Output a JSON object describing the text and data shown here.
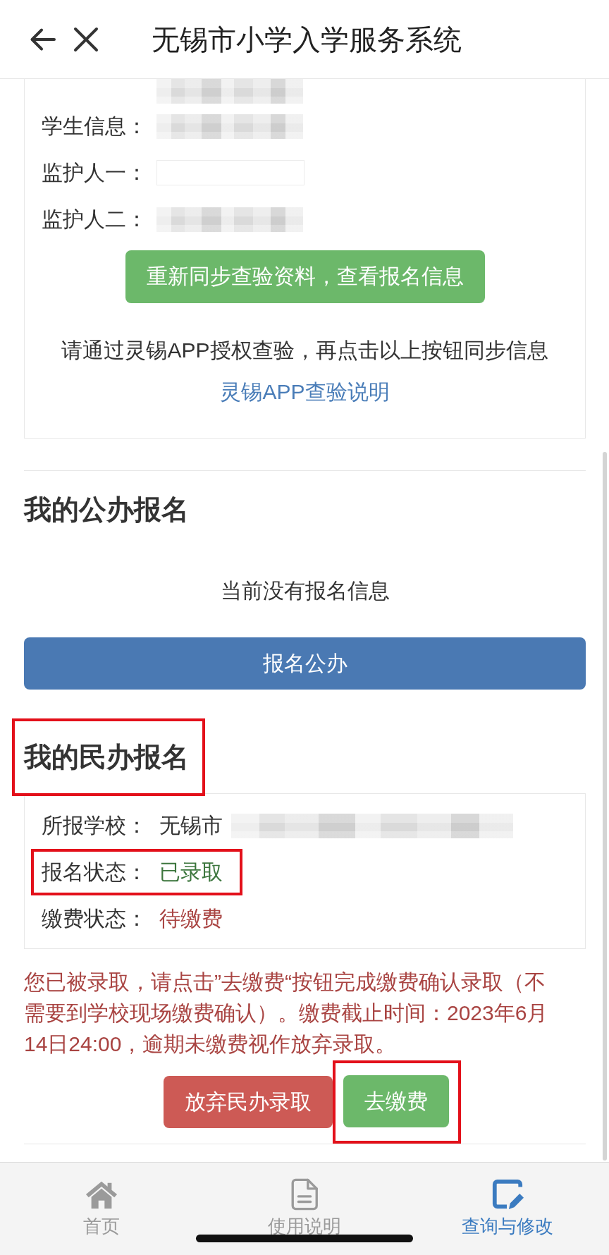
{
  "header": {
    "title": "无锡市小学入学服务系统"
  },
  "student_info": {
    "rows": [
      {
        "kind": "blurred"
      },
      {
        "label": "学生信息：",
        "kind": "blurred"
      },
      {
        "label": "监护人一：",
        "kind": "blank"
      },
      {
        "label": "监护人二：",
        "kind": "blurred"
      }
    ],
    "sync_button": {
      "label": "重新同步查验资料，查看报名信息",
      "kind": "success"
    },
    "instruction": "请通过灵锡APP授权查验，再点击以上按钮同步信息",
    "help_link": "灵锡APP查验说明"
  },
  "public_section": {
    "title": "我的公办报名",
    "empty_message": "当前没有报名信息",
    "apply_button": {
      "label": "报名公办",
      "kind": "primary"
    }
  },
  "private_section": {
    "title": "我的民办报名",
    "highlighted": true,
    "rows": [
      {
        "label": "所报学校：",
        "value": "无锡市",
        "kind": "partly_blurred",
        "color": "#333333",
        "highlighted": false
      },
      {
        "label": "报名状态：",
        "value": "已录取",
        "kind": "text",
        "color": "#3c763d",
        "highlighted": true
      },
      {
        "label": "缴费状态：",
        "value": "待缴费",
        "kind": "text",
        "color": "#a94442",
        "highlighted": false
      }
    ],
    "notice": "您已被录取，请点击”去缴费“按钮完成缴费确认录取（不需要到学校现场缴费确认）。缴费截止时间：2023年6月14日24:00，逾期未缴费视作放弃录取。",
    "actions": [
      {
        "label": "放弃民办录取",
        "kind": "danger",
        "highlighted": false
      },
      {
        "label": "去缴费",
        "kind": "success",
        "highlighted": true
      }
    ]
  },
  "tab_bar": [
    {
      "label": "首页",
      "selected": false
    },
    {
      "label": "使用说明",
      "selected": false
    },
    {
      "label": "查询与修改",
      "selected": true
    }
  ]
}
